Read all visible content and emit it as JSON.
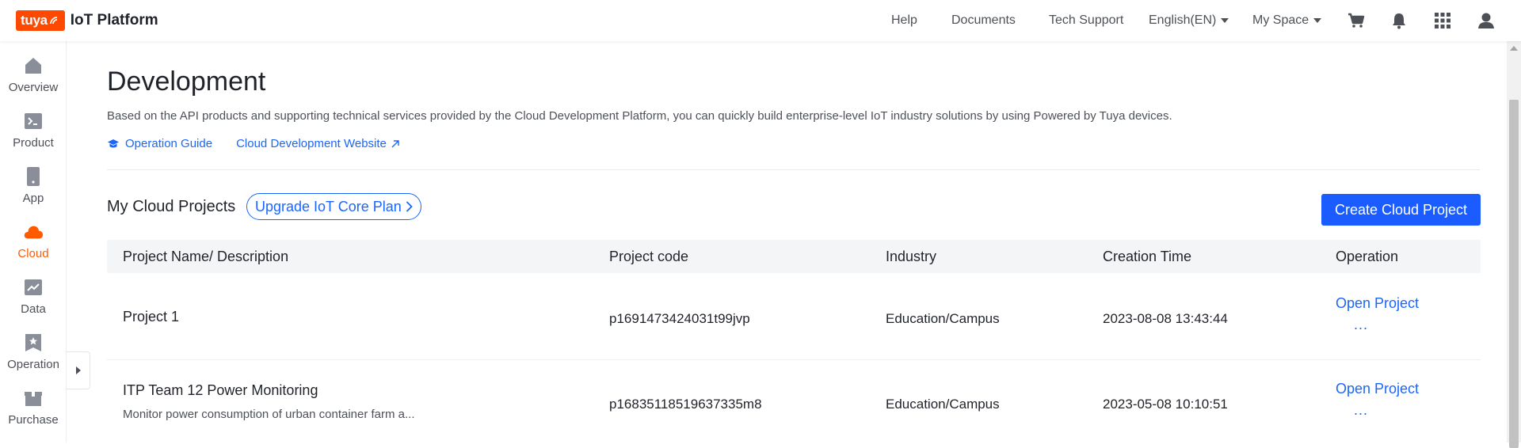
{
  "header": {
    "logo_badge": "tuya",
    "logo_text": "IoT Platform",
    "nav": {
      "help": "Help",
      "documents": "Documents",
      "tech_support": "Tech Support",
      "language": "English(EN)",
      "space": "My Space"
    },
    "icons": [
      "cart-icon",
      "bell-icon",
      "apps-grid-icon",
      "user-icon"
    ]
  },
  "sidebar": {
    "items": [
      {
        "label": "Overview",
        "icon": "home-icon"
      },
      {
        "label": "Product",
        "icon": "terminal-icon"
      },
      {
        "label": "App",
        "icon": "phone-icon"
      },
      {
        "label": "Cloud",
        "icon": "cloud-icon",
        "active": true
      },
      {
        "label": "Data",
        "icon": "chart-icon"
      },
      {
        "label": "Operation",
        "icon": "bookmark-star-icon"
      },
      {
        "label": "Purchase",
        "icon": "box-icon"
      }
    ],
    "active_color": "#ff5a00"
  },
  "main": {
    "title": "Development",
    "description": "Based on the API products and supporting technical services provided by the Cloud Development Platform, you can quickly build enterprise-level IoT industry solutions by using Powered by Tuya devices.",
    "links": {
      "operation_guide": "Operation Guide",
      "cloud_dev_website": "Cloud Development Website"
    },
    "section_title": "My Cloud Projects",
    "upgrade_label": "Upgrade IoT Core Plan",
    "create_label": "Create Cloud Project",
    "accent_color": "#1a5cff"
  },
  "table": {
    "columns": [
      "Project Name/ Description",
      "Project code",
      "Industry",
      "Creation Time",
      "Operation"
    ],
    "rows": [
      {
        "name": "Project 1",
        "description": "",
        "code": "p1691473424031t99jvp",
        "industry": "Education/Campus",
        "created": "2023-08-08 13:43:44",
        "open": "Open Project",
        "more": "..."
      },
      {
        "name": "ITP Team 12 Power Monitoring",
        "description": "Monitor power consumption of urban container farm a...",
        "code": "p16835118519637335m8",
        "industry": "Education/Campus",
        "created": "2023-05-08 10:10:51",
        "open": "Open Project",
        "more": "..."
      }
    ]
  }
}
